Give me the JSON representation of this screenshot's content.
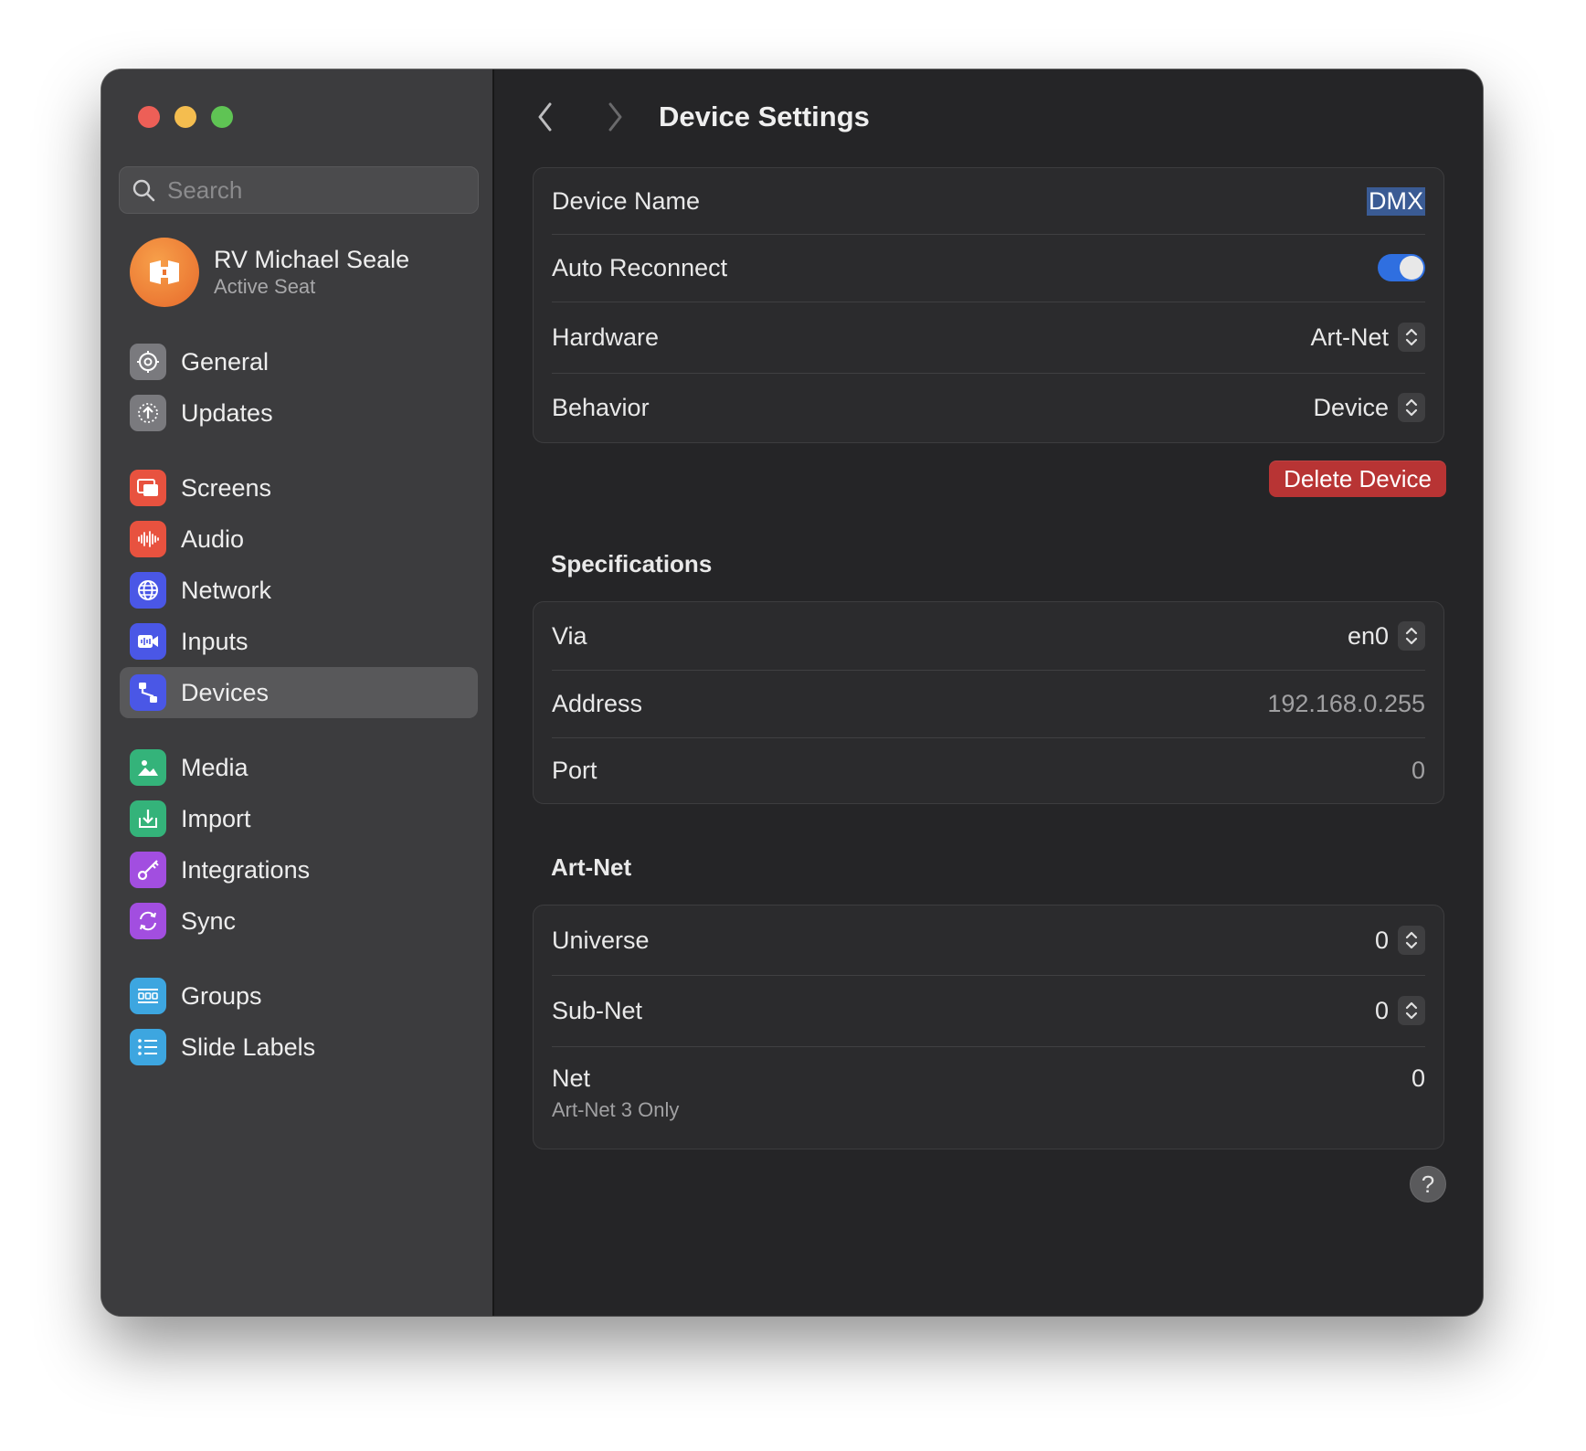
{
  "window": {
    "traffic_lights": [
      "close",
      "minimize",
      "zoom"
    ]
  },
  "sidebar": {
    "search": {
      "placeholder": "Search",
      "value": ""
    },
    "profile": {
      "name": "RV Michael Seale",
      "subtitle": "Active Seat"
    },
    "groups": [
      [
        {
          "label": "General",
          "icon": "gear-icon",
          "color": "#8e8e93"
        },
        {
          "label": "Updates",
          "icon": "update-arrow-icon",
          "color": "#8e8e93"
        }
      ],
      [
        {
          "label": "Screens",
          "icon": "screens-icon",
          "color": "#e8523f"
        },
        {
          "label": "Audio",
          "icon": "waveform-icon",
          "color": "#e8523f"
        },
        {
          "label": "Network",
          "icon": "globe-icon",
          "color": "#4a57e6"
        },
        {
          "label": "Inputs",
          "icon": "video-input-icon",
          "color": "#4a57e6"
        },
        {
          "label": "Devices",
          "icon": "devices-icon",
          "color": "#4a57e6",
          "active": true
        }
      ],
      [
        {
          "label": "Media",
          "icon": "photo-icon",
          "color": "#34b37a"
        },
        {
          "label": "Import",
          "icon": "import-icon",
          "color": "#34b37a"
        },
        {
          "label": "Integrations",
          "icon": "key-icon",
          "color": "#a24ee0"
        },
        {
          "label": "Sync",
          "icon": "sync-icon",
          "color": "#a24ee0"
        }
      ],
      [
        {
          "label": "Groups",
          "icon": "groups-icon",
          "color": "#3da6e0"
        },
        {
          "label": "Slide Labels",
          "icon": "list-icon",
          "color": "#3da6e0"
        }
      ]
    ]
  },
  "header": {
    "title": "Device Settings"
  },
  "device": {
    "name_label": "Device Name",
    "name_value": "DMX",
    "auto_reconnect_label": "Auto Reconnect",
    "auto_reconnect_on": true,
    "hardware_label": "Hardware",
    "hardware_value": "Art-Net",
    "behavior_label": "Behavior",
    "behavior_value": "Device",
    "delete_label": "Delete Device"
  },
  "specifications": {
    "title": "Specifications",
    "via_label": "Via",
    "via_value": "en0",
    "address_label": "Address",
    "address_value": "192.168.0.255",
    "port_label": "Port",
    "port_value": "0"
  },
  "artnet": {
    "title": "Art-Net",
    "universe_label": "Universe",
    "universe_value": "0",
    "subnet_label": "Sub-Net",
    "subnet_value": "0",
    "net_label": "Net",
    "net_value": "0",
    "net_note": "Art-Net 3 Only"
  },
  "help_label": "?"
}
